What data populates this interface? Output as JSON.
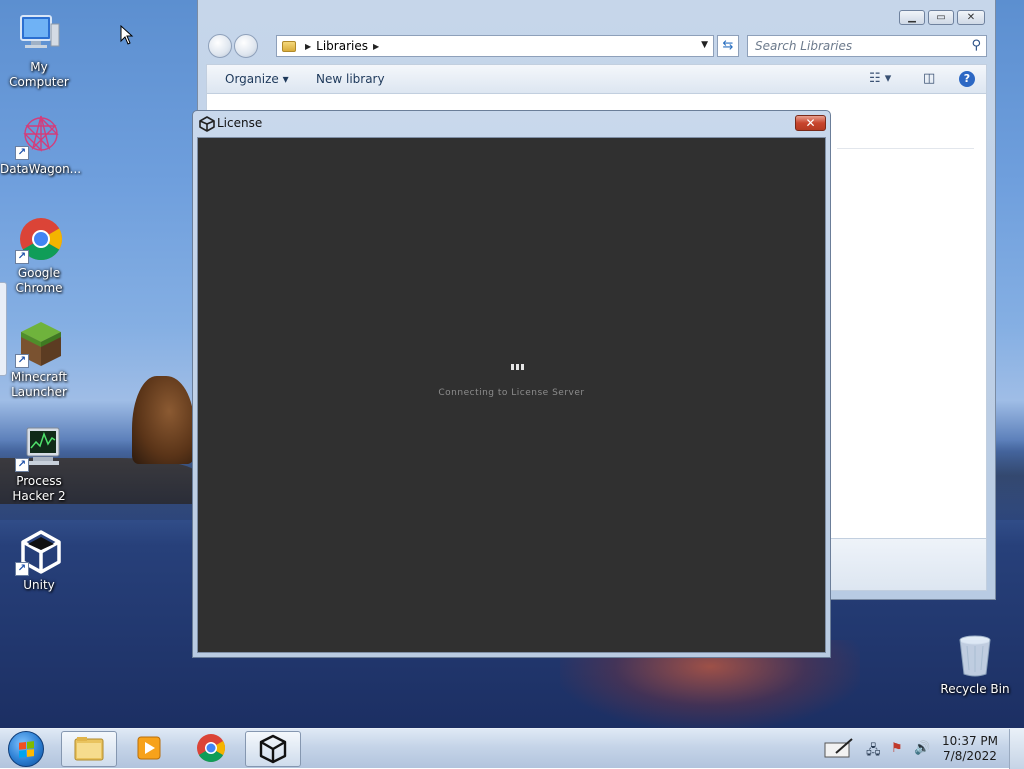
{
  "desktop": {
    "icons": [
      {
        "label": "My Computer"
      },
      {
        "label": "DataWagon..."
      },
      {
        "label": "Google Chrome"
      },
      {
        "label": "Minecraft Launcher"
      },
      {
        "label": "Process Hacker 2"
      },
      {
        "label": "Unity"
      },
      {
        "label": "Recycle Bin"
      }
    ]
  },
  "explorer": {
    "address": {
      "crumb": "Libraries"
    },
    "search": {
      "placeholder": "Search Libraries"
    },
    "toolbar": {
      "organize": "Organize",
      "new_library": "New library"
    }
  },
  "license_dialog": {
    "title": "License",
    "status": "Connecting to License Server"
  },
  "taskbar": {
    "clock": {
      "time": "10:37 PM",
      "date": "7/8/2022"
    }
  }
}
